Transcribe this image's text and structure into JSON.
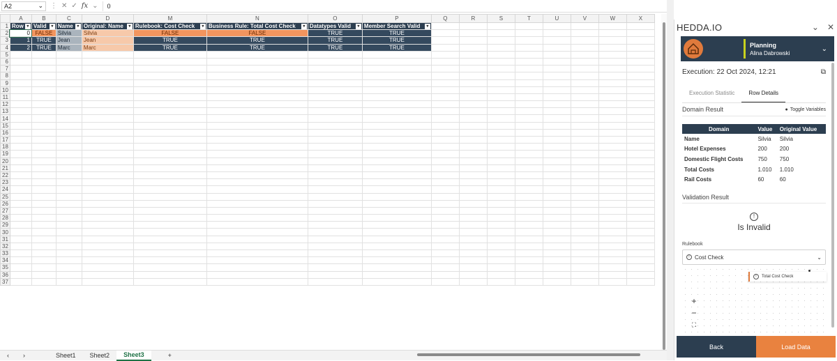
{
  "formula_bar": {
    "name_box": "A2",
    "icons": [
      "close-icon",
      "check-icon",
      "fx-icon"
    ],
    "fx_label": "fx",
    "value": "0"
  },
  "columns": [
    "A",
    "B",
    "C",
    "D",
    "M",
    "N",
    "O",
    "P",
    "Q",
    "R",
    "S",
    "T",
    "U",
    "V",
    "W",
    "X"
  ],
  "table_headers": [
    "Row",
    "Valid",
    "Name",
    "Original: Name",
    "Rulebook: Cost Check",
    "Business Rule: Total Cost Check",
    "Datatypes Valid",
    "Member Search Valid"
  ],
  "rows": [
    [
      "0",
      "FALSE",
      "Silvia",
      "Silvia",
      "FALSE",
      "FALSE",
      "TRUE",
      "TRUE"
    ],
    [
      "1",
      "TRUE",
      "Jean",
      "Jean",
      "TRUE",
      "TRUE",
      "TRUE",
      "TRUE"
    ],
    [
      "2",
      "TRUE",
      "Marc",
      "Marc",
      "TRUE",
      "TRUE",
      "TRUE",
      "TRUE"
    ]
  ],
  "row_numbers": [
    "1",
    "2",
    "3",
    "4",
    "5",
    "6",
    "7",
    "8",
    "9",
    "10",
    "11",
    "12",
    "13",
    "14",
    "15",
    "16",
    "17",
    "18",
    "19",
    "20",
    "21",
    "22",
    "23",
    "24",
    "25",
    "26",
    "27",
    "28",
    "29",
    "30",
    "31",
    "32",
    "33",
    "34",
    "35",
    "36",
    "37"
  ],
  "sheet_tabs": [
    "Sheet1",
    "Sheet2",
    "Sheet3"
  ],
  "active_sheet": "Sheet3",
  "add_sheet": "+",
  "panel": {
    "title": "HEDDA.IO",
    "user": {
      "workspace": "Planning",
      "name": "Alina Dabrowski"
    },
    "execution": "Execution: 22 Oct 2024, 12:21",
    "tabs": [
      "Execution Statistic",
      "Row Details"
    ],
    "active_tab": "Row Details",
    "domain_result_title": "Domain Result",
    "toggle_label": "Toggle Variables",
    "domain_headers": [
      "Domain",
      "Value",
      "Original Value"
    ],
    "domain_rows": [
      [
        "Name",
        "Silvia",
        "Silvia"
      ],
      [
        "Hotel Expenses",
        "200",
        "200"
      ],
      [
        "Domestic Flight Costs",
        "750",
        "750"
      ],
      [
        "Total Costs",
        "1.010",
        "1.010"
      ],
      [
        "Rail Costs",
        "60",
        "60"
      ]
    ],
    "validation_title": "Validation Result",
    "validation_status": "Is Invalid",
    "rulebook_label": "Rulebook",
    "rulebook_value": "Cost Check",
    "node_label": "Total Cost Check",
    "zoom_controls": [
      "+",
      "−",
      "⛶"
    ],
    "back_label": "Back",
    "load_label": "Load Data"
  },
  "colors": {
    "dark_header": "#2c3e50",
    "invalid_orange": "#f2955f",
    "accent_orange": "#e9823f",
    "accent_lime": "#c8d21e"
  }
}
